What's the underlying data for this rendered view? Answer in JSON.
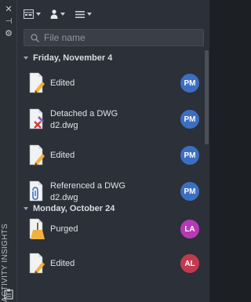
{
  "side": {
    "title": "ACTIVITY INSIGHTS",
    "close_glyph": "✕",
    "autohide_glyph": "⊣",
    "settings_glyph": "⚙"
  },
  "toolbar": {
    "icons": [
      "display-options-icon",
      "user-filter-icon",
      "list-options-icon"
    ]
  },
  "search": {
    "placeholder": "File name",
    "value": ""
  },
  "groups": [
    {
      "date": "Friday, November 4",
      "items": [
        {
          "action": "Edited",
          "detail": "",
          "initials": "PM",
          "color": "#3c6fc4"
        },
        {
          "action": "Detached a DWG",
          "detail": "d2.dwg",
          "initials": "PM",
          "color": "#3c6fc4"
        },
        {
          "action": "Edited",
          "detail": "",
          "initials": "PM",
          "color": "#3c6fc4"
        },
        {
          "action": "Referenced a DWG",
          "detail": "d2.dwg",
          "initials": "PM",
          "color": "#3c6fc4"
        }
      ]
    },
    {
      "date": "Monday, October 24",
      "items": [
        {
          "action": "Purged",
          "detail": "",
          "initials": "LA",
          "color": "#b63ab4"
        },
        {
          "action": "Edited",
          "detail": "",
          "initials": "AL",
          "color": "#c23a50"
        }
      ]
    }
  ],
  "colors": {
    "panel_bg": "#2c3038",
    "accent_caret": "#8aa6c8"
  }
}
